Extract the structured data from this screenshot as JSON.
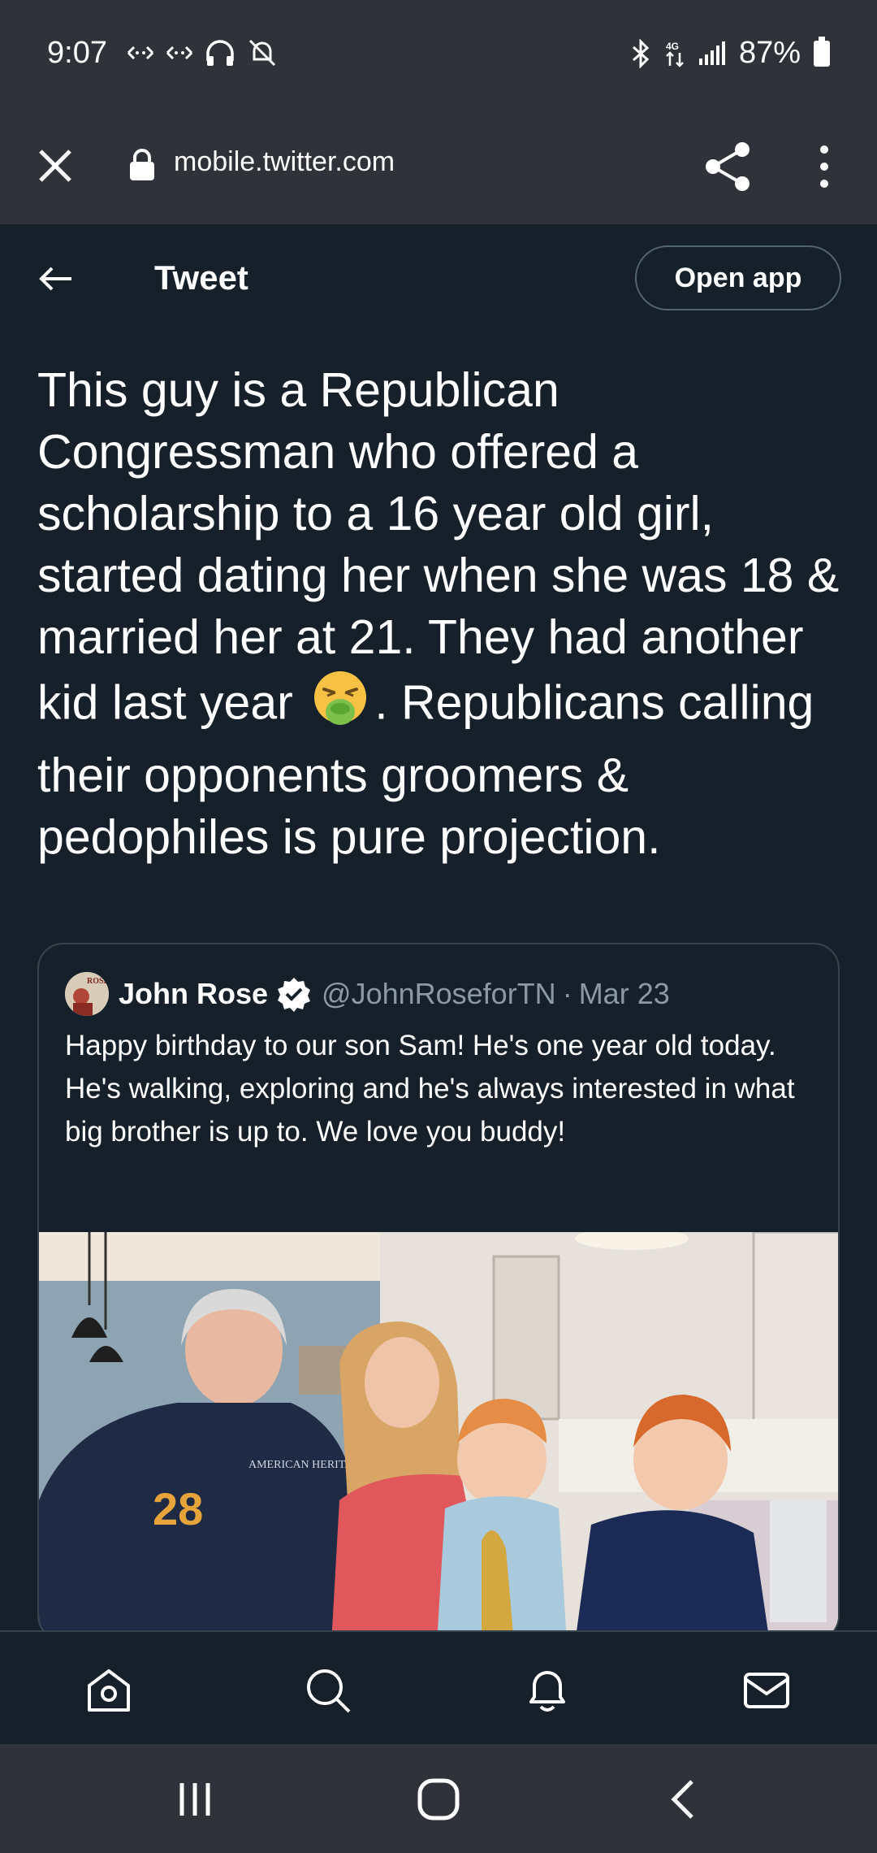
{
  "status_bar": {
    "time": "9:07",
    "battery": "87%"
  },
  "browser": {
    "url": "mobile.twitter.com"
  },
  "header": {
    "title": "Tweet",
    "open_app_label": "Open app"
  },
  "tweet": {
    "text_before_emoji": "This guy is a Republican Congressman who offered a scholarship to a 16 year old girl, started dating her when she was 18 & married her at 21. They had another kid last year",
    "text_after_emoji": ". Republicans calling their opponents groomers & pedophiles is pure projection.",
    "emoji_icon": "vomiting-face-icon"
  },
  "quoted_tweet": {
    "avatar_text": "ROSE",
    "name": "John Rose",
    "handle": "@JohnRoseforTN",
    "separator": "·",
    "date": "Mar 23",
    "text": "Happy birthday to our son Sam! He's one year old today. He's walking, exploring and he's always interested in what big brother is up to. We love you buddy!",
    "photo_jersey_number": "28",
    "photo_shirt_text": "AMERICAN HERITAGE FFA"
  },
  "bottom_nav": {
    "items": [
      "home-icon",
      "search-icon",
      "notifications-icon",
      "messages-icon"
    ]
  },
  "colors": {
    "background": "#15202b",
    "chrome": "#2f3238",
    "border": "#38444d",
    "secondary_text": "#8b98a5"
  }
}
